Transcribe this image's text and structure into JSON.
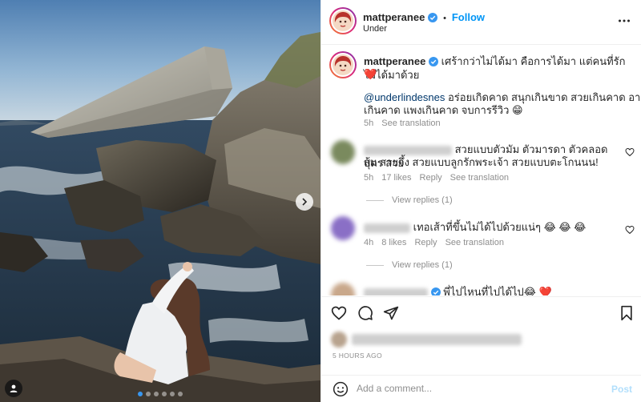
{
  "post": {
    "username": "mattperanee",
    "follow_label": "Follow",
    "separator": "•",
    "location": "Under",
    "more_icon": "more-horizontal-icon"
  },
  "caption": {
    "username": "mattperanee",
    "line1": "เศร้ากว่าไม่ได้มา คือการได้มา แต่คนที่รักไม่ได้มาด้วย",
    "line2": "❤️",
    "mention": "@underlindesnes",
    "line3_rest": " อร่อยเกิดคาด สนุกเกินขาด สวยเกินคาด อากาศดี",
    "line4": "เกินคาด แพงเกินคาด จบการรีวิว 😁",
    "time": "5h",
    "see_translation": "See translation"
  },
  "comments": [
    {
      "text_line1": "สวยแบบตัวมัม ตัวมารดา ตัวคลอดบุตร สวย",
      "text_line2": "ส้ม สวยจึ้ง สวยแบบลูกรักพระเจ้า สวยแบบตะโกนนน!",
      "time": "5h",
      "likes": "17 likes",
      "reply": "Reply",
      "see_translation": "See translation",
      "view_replies": "View replies (1)"
    },
    {
      "text_line1": "เทอเส้าที่ขึ้นไม่ได้ไปด้วยแน่ๆ 😂 😂 😂",
      "time": "4h",
      "likes": "8 likes",
      "reply": "Reply",
      "see_translation": "See translation",
      "view_replies": "View replies (1)"
    },
    {
      "text_line1": "พี่ไปไหนที่ไปได้ไป😂 ❤️"
    }
  ],
  "footer": {
    "timestamp": "5 HOURS AGO",
    "comment_placeholder": "Add a comment...",
    "post_label": "Post"
  },
  "colors": {
    "accent": "#0095f6",
    "verified": "#3897f0",
    "heart": "#ed4956",
    "muted": "#8e8e8e"
  },
  "carousel": {
    "slide_count": 6,
    "active_index": 0
  }
}
